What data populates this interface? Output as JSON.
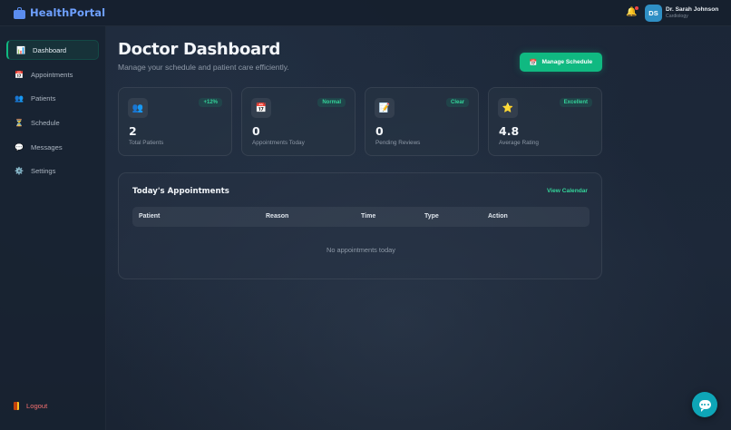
{
  "app": {
    "name": "HealthPortal",
    "icon": "briefcase-icon"
  },
  "topbar": {
    "notification_icon": "bell-icon",
    "notification_dot_color": "#ef4444",
    "user": {
      "initials": "DS",
      "name": "Dr. Sarah Johnson",
      "role": "Cardiology"
    }
  },
  "sidebar": {
    "items": [
      {
        "label": "Dashboard",
        "icon": "chart-icon",
        "glyph": "📊",
        "active": true
      },
      {
        "label": "Appointments",
        "icon": "calendar-icon",
        "glyph": "📅",
        "active": false
      },
      {
        "label": "Patients",
        "icon": "users-icon",
        "glyph": "👥",
        "active": false
      },
      {
        "label": "Schedule",
        "icon": "hourglass-icon",
        "glyph": "⏳",
        "active": false
      },
      {
        "label": "Messages",
        "icon": "chat-icon",
        "glyph": "💬",
        "active": false
      },
      {
        "label": "Settings",
        "icon": "gear-icon",
        "glyph": "⚙️",
        "active": false
      }
    ],
    "logout_label": "Logout"
  },
  "header": {
    "title": "Doctor Dashboard",
    "subtitle": "Manage your schedule and patient care efficiently.",
    "manage_button": {
      "label": "Manage Schedule",
      "glyph": "📅"
    }
  },
  "stats": [
    {
      "value": "2",
      "label": "Total Patients",
      "badge": "+12%",
      "icon": "users-icon",
      "glyph": "👥"
    },
    {
      "value": "0",
      "label": "Appointments Today",
      "badge": "Normal",
      "icon": "calendar-icon",
      "glyph": "📅"
    },
    {
      "value": "0",
      "label": "Pending Reviews",
      "badge": "Clear",
      "icon": "memo-icon",
      "glyph": "📝"
    },
    {
      "value": "4.8",
      "label": "Average Rating",
      "badge": "Excellent",
      "icon": "star-icon",
      "glyph": "⭐"
    }
  ],
  "appointments": {
    "title": "Today's Appointments",
    "link_label": "View Calendar",
    "columns": [
      "Patient",
      "Reason",
      "Time",
      "Type",
      "Action"
    ],
    "rows": [],
    "empty_message": "No appointments today"
  },
  "colors": {
    "accent": "#10b981",
    "brand": "#6ea0ff",
    "danger": "#f87171"
  },
  "chat_fab": {
    "icon": "chat-bubble-icon"
  }
}
